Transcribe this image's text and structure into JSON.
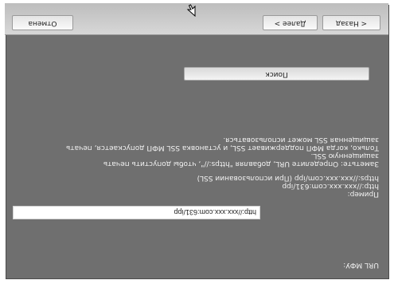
{
  "form": {
    "url_label": "URL МФУ:",
    "url_value": "http://xxx.xxx.com:631/ipp",
    "example_lines": [
      "Пример:",
      "http://xxx.xxx.com:631/ipp",
      "https://xxx.xxx.com/ipp (При использовании SSL)"
    ],
    "note_lines": [
      "Заметьте: Определите URL, добавляя \"https://\", чтобы допустить печать",
      "защищенную SSL.",
      "Только, когда МФП поддерживает SSL, и установка SSL МФП допускается, печать",
      "защищенная SSL может использоваться."
    ],
    "search_label": "Поиск"
  },
  "nav": {
    "back_label": "< Назад",
    "next_label": "Далее >",
    "cancel_label": "Отмена"
  }
}
